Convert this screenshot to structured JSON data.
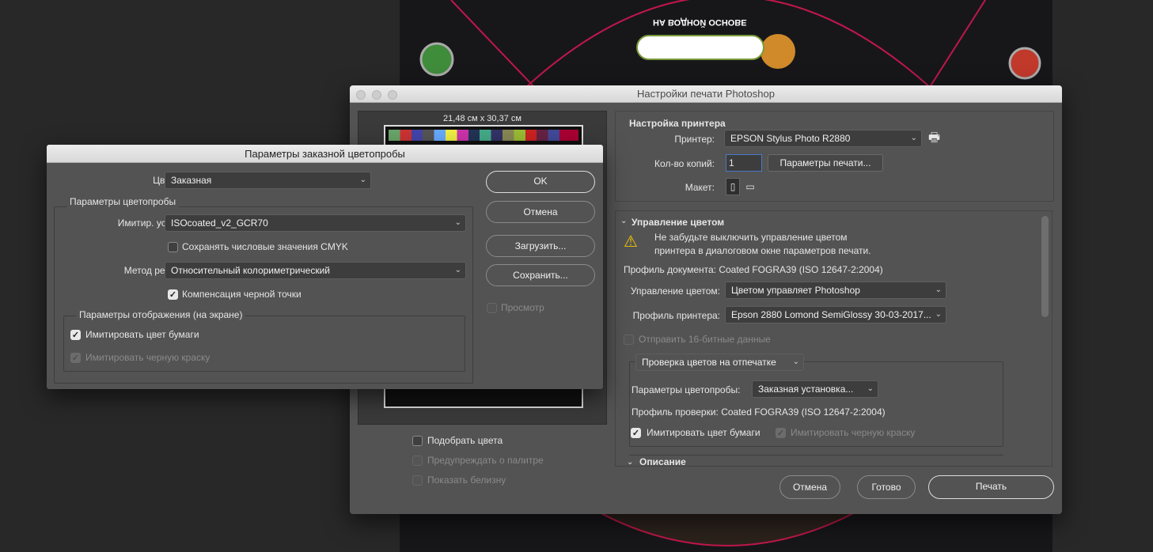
{
  "artwork": {
    "headline": "НА ВОДНОЙ ОСНОВЕ",
    "accent": "#c0174a"
  },
  "print_dialog": {
    "title": "Настройки печати Photoshop",
    "preview": {
      "size_label": "21,48 см x 30,37 см",
      "match_colors": {
        "label": "Подобрать цвета",
        "checked": false
      },
      "gamut_warning": {
        "label": "Предупреждать о палитре",
        "checked": false,
        "disabled": true
      },
      "show_paper_white": {
        "label": "Показать белизну",
        "checked": false,
        "disabled": true
      }
    },
    "printer_setup": {
      "heading": "Настройка принтера",
      "printer_label": "Принтер:",
      "printer_value": "EPSON Stylus Photo R2880",
      "copies_label": "Кол-во копий:",
      "copies_value": "1",
      "print_settings_button": "Параметры печати...",
      "layout_label": "Макет:"
    },
    "color_management": {
      "heading": "Управление цветом",
      "warning": [
        "Не забудьте выключить управление цветом",
        "принтера в диалоговом окне параметров печати."
      ],
      "document_profile": "Профиль документа: Coated FOGRA39 (ISO 12647-2:2004)",
      "handling_label": "Управление цветом:",
      "handling_value": "Цветом управляет Photoshop",
      "printer_profile_label": "Профиль принтера:",
      "printer_profile_value": "Epson 2880 Lomond SemiGlossy 30-03-2017...",
      "send_16bit": {
        "label": "Отправить 16-битные данные",
        "checked": false,
        "disabled": true
      },
      "proof_mode": "Проверка цветов на отпечатке",
      "proof_setup_label": "Параметры цветопробы:",
      "proof_setup_value": "Заказная установка...",
      "proof_profile": "Профиль проверки: Coated FOGRA39 (ISO 12647-2:2004)",
      "simulate_paper": {
        "label": "Имитировать цвет бумаги",
        "checked": true
      },
      "simulate_black": {
        "label": "Имитировать черную краску",
        "checked": true,
        "disabled": true
      }
    },
    "description_heading": "Описание",
    "buttons": {
      "cancel": "Отмена",
      "done": "Готово",
      "print": "Печать"
    }
  },
  "proof_dialog": {
    "title": "Параметры заказной цветопробы",
    "proof_label": "Цветопроба:",
    "proof_value": "Заказная",
    "group_title": "Параметры цветопробы",
    "device_label": "Имитир. устройство:",
    "device_value": "ISOcoated_v2_GCR70",
    "preserve_cmyk": {
      "label": "Сохранять числовые значения CMYK",
      "checked": false
    },
    "intent_label": "Метод рендеринга:",
    "intent_value": "Относительный колориметрический",
    "bpc": {
      "label": "Компенсация черной точки",
      "checked": true
    },
    "display_group_title": "Параметры отображения (на экране)",
    "simulate_paper": {
      "label": "Имитировать цвет бумаги",
      "checked": true
    },
    "simulate_black": {
      "label": "Имитировать черную краску",
      "checked": true,
      "disabled": true
    },
    "buttons": {
      "ok": "OK",
      "cancel": "Отмена",
      "load": "Загрузить...",
      "save": "Сохранить..."
    },
    "preview": {
      "label": "Просмотр",
      "checked": false,
      "disabled": true
    }
  }
}
